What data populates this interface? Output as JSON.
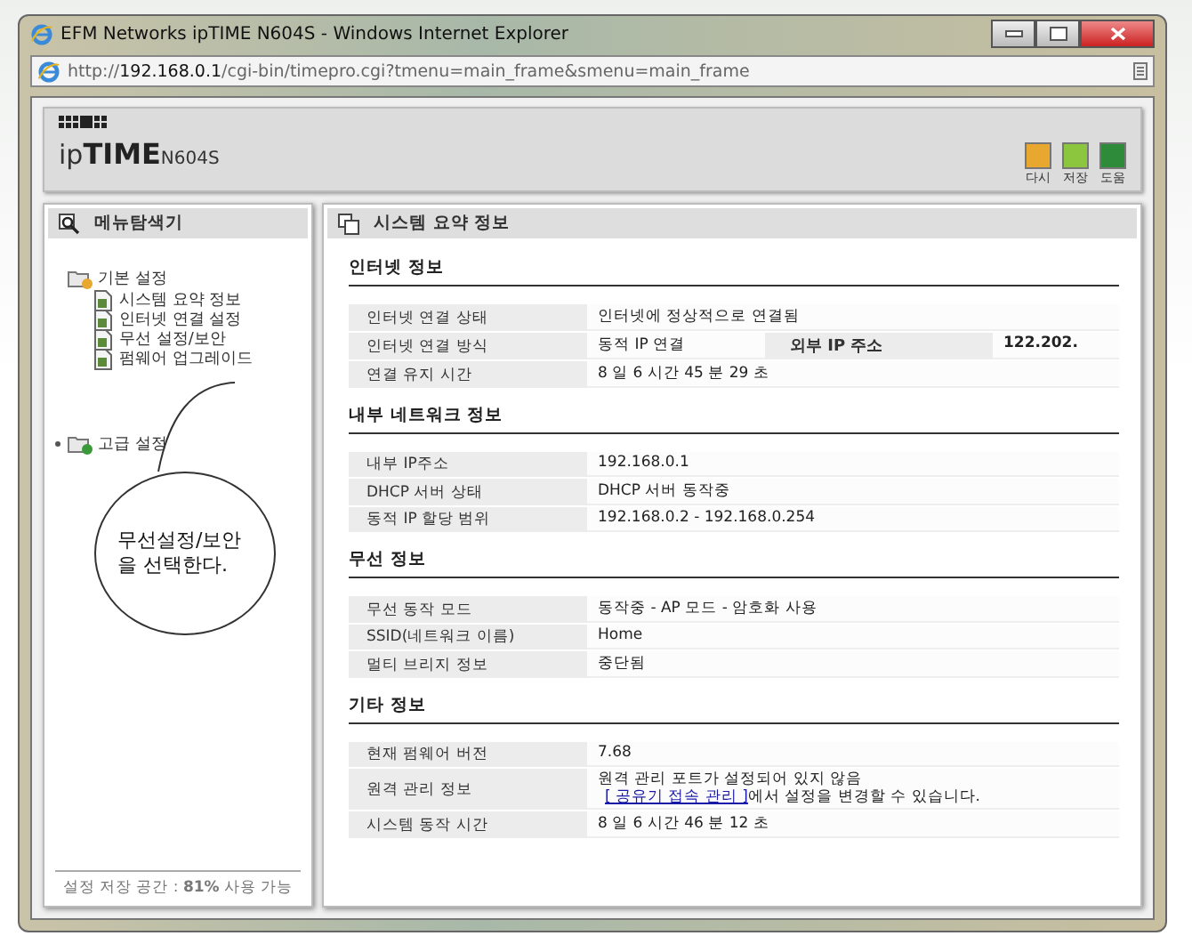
{
  "window": {
    "title": "EFM Networks ipTIME N604S - Windows Internet Explorer"
  },
  "address_bar": {
    "url_scheme": "http://",
    "url_host": "192.168.0.1",
    "url_path": "/cgi-bin/timepro.cgi?tmenu=main_frame&smenu=main_frame"
  },
  "header": {
    "logo_light": "ip",
    "logo_bold": "TIME",
    "model": "N604S",
    "toolbar": [
      {
        "label": "다시",
        "color": "#e8a830"
      },
      {
        "label": "저장",
        "color": "#8cc63f"
      },
      {
        "label": "도움",
        "color": "#2e8b3a"
      }
    ]
  },
  "sidebar": {
    "title": "메뉴탐색기",
    "tree": [
      {
        "label": "기본 설정",
        "expanded": true,
        "children": [
          {
            "label": "시스템 요약 정보"
          },
          {
            "label": "인터넷 연결 설정"
          },
          {
            "label": "무선 설정/보안"
          },
          {
            "label": "펌웨어 업그레이드"
          }
        ]
      },
      {
        "label": "고급 설정",
        "expanded": false
      }
    ],
    "footer": "설정 저장 공간 : **81%** 사용 가능"
  },
  "callout": {
    "text": "무선설정/보안을 선택한다."
  },
  "main": {
    "title": "시스템 요약 정보",
    "sections": [
      {
        "title": "인터넷 정보",
        "rows": [
          {
            "kind": "text",
            "label": "인터넷 연결 상태",
            "value": "인터넷에 정상적으로 연결됨"
          },
          {
            "kind": "pair",
            "label": "인터넷 연결 방식",
            "value": "동적 IP 연결",
            "extra_label": "외부 IP 주소",
            "extra_value": "122.202."
          },
          {
            "kind": "text",
            "label": "연결 유지 시간",
            "value": "8 일 6 시간 45 분 29 초"
          }
        ]
      },
      {
        "title": "내부 네트워크 정보",
        "rows": [
          {
            "kind": "text",
            "label": "내부 IP주소",
            "value": "192.168.0.1"
          },
          {
            "kind": "text",
            "label": "DHCP 서버 상태",
            "value": "DHCP 서버 동작중"
          },
          {
            "kind": "text",
            "label": "동적 IP 할당 범위",
            "value": "192.168.0.2 -  192.168.0.254"
          }
        ]
      },
      {
        "title": "무선 정보",
        "rows": [
          {
            "kind": "text",
            "label": "무선 동작 모드",
            "value": "동작중 - AP 모드 - 암호화 사용"
          },
          {
            "kind": "text",
            "label": "SSID(네트워크 이름)",
            "value": "Home"
          },
          {
            "kind": "text",
            "label": "멀티 브리지 정보",
            "value": "중단됨"
          }
        ]
      },
      {
        "title": "기타 정보",
        "rows": [
          {
            "kind": "text",
            "label": "현재 펌웨어 버전",
            "value": "7.68"
          },
          {
            "kind": "link",
            "label": "원격 관리 정보",
            "value": "원격 관리 포트가 설정되어 있지 않음",
            "link": "[ 공유기 접속 관리 ]",
            "after": "에서 설정을 변경할 수 있습니다."
          },
          {
            "kind": "text",
            "label": "시스템 동작 시간",
            "value": "8 일 6 시간 46 분 12 초"
          }
        ]
      }
    ]
  }
}
